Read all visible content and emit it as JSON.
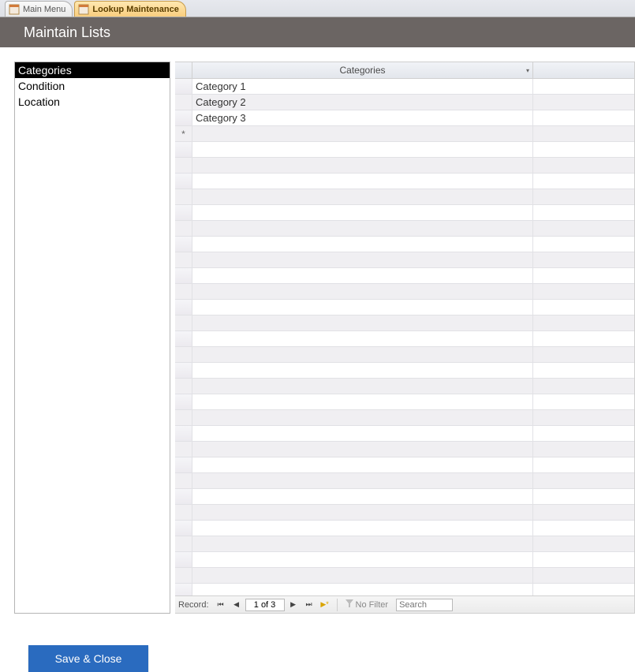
{
  "tabs": [
    {
      "label": "Main Menu",
      "active": false
    },
    {
      "label": "Lookup Maintenance",
      "active": true
    }
  ],
  "header": {
    "title": "Maintain Lists"
  },
  "sidebar": {
    "items": [
      {
        "label": "Categories",
        "selected": true
      },
      {
        "label": "Condition",
        "selected": false
      },
      {
        "label": "Location",
        "selected": false
      }
    ]
  },
  "datasheet": {
    "column_header": "Categories",
    "rows": [
      {
        "value": "Category 1"
      },
      {
        "value": "Category 2"
      },
      {
        "value": "Category 3"
      }
    ],
    "new_row_marker": "*"
  },
  "recnav": {
    "label": "Record:",
    "position": "1 of 3",
    "filter_label": "No Filter",
    "search_placeholder": "Search"
  },
  "buttons": {
    "save_close": "Save & Close"
  }
}
